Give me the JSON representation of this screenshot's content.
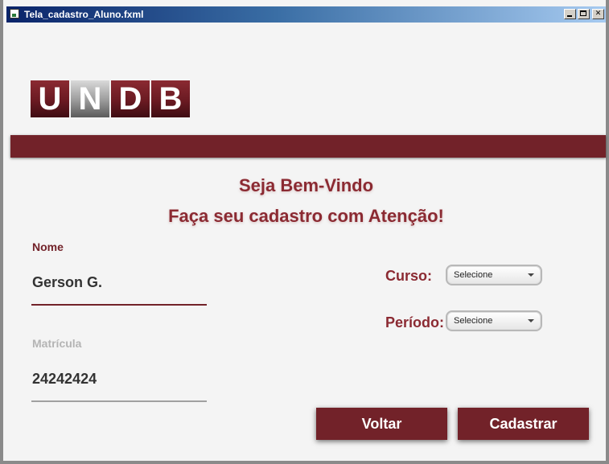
{
  "window": {
    "title": "Tela_cadastro_Aluno.fxml"
  },
  "logo": {
    "letters": [
      "U",
      "N",
      "D",
      "B"
    ]
  },
  "header": {
    "welcome": "Seja Bem-Vindo",
    "instruction": "Faça seu cadastro com Atenção!"
  },
  "form": {
    "nome": {
      "label": "Nome",
      "value": "Gerson G."
    },
    "matricula": {
      "label": "Matrícula",
      "value": "24242424"
    },
    "curso": {
      "label": "Curso:",
      "selected": "Selecione"
    },
    "periodo": {
      "label": "Período:",
      "selected": "Selecione"
    }
  },
  "buttons": {
    "voltar": "Voltar",
    "cadastrar": "Cadastrar"
  },
  "colors": {
    "brand": "#722229",
    "accent_text": "#8b2a32",
    "title_bar": "#0a246a"
  }
}
